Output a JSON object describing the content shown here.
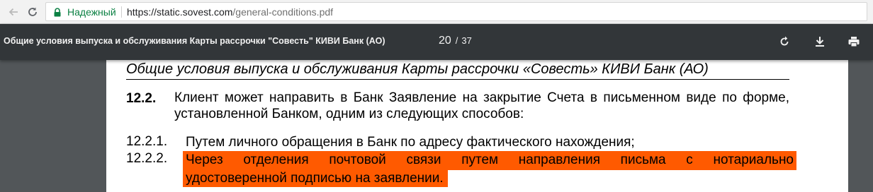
{
  "browser": {
    "secure_label": "Надежный",
    "url_host": "https://static.sovest.com",
    "url_path": "/general-conditions.pdf",
    "icons": [
      "back-icon",
      "reload-icon",
      "lock-icon"
    ]
  },
  "pdf_toolbar": {
    "title": "Общие условия выпуска и обслуживания Карты рассрочки \"Совесть\" КИВИ Банк (АО)",
    "page_current": "20",
    "page_separator": "/",
    "page_total": "37",
    "icons": [
      "rotate-icon",
      "download-icon",
      "print-icon"
    ]
  },
  "document": {
    "header": "Общие условия выпуска и обслуживания Карты рассрочки «Совесть» КИВИ Банк (АО)",
    "section_number": "12.2.",
    "section_text": "Клиент может направить в Банк Заявление на закрытие Счета в письменном виде по форме, установленной Банком, одним из следующих способов:",
    "items": [
      {
        "number": "12.2.1.",
        "text": "Путем личного обращения в Банк по адресу фактического нахождения;"
      },
      {
        "number": "12.2.2.",
        "text_line1": "Через отделения почтовой связи путем направления письма с нотариально",
        "text_line2": "удостоверенной подписью на заявлении."
      }
    ],
    "highlight_color": "#ff5a00"
  }
}
